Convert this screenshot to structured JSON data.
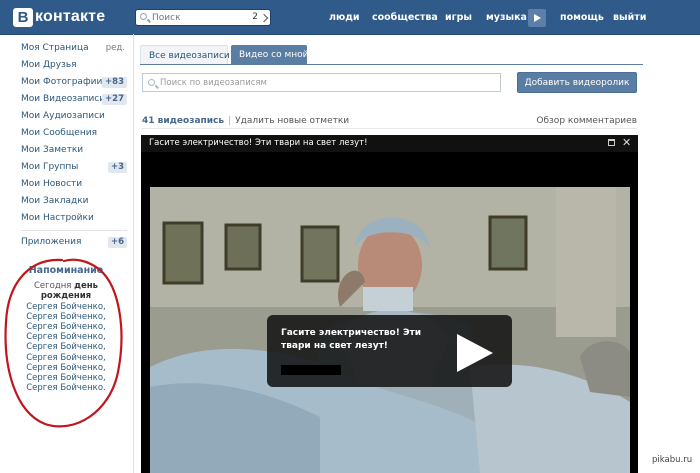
{
  "header": {
    "logo_letter": "B",
    "logo_text": "контакте",
    "search_placeholder": "Поиск",
    "search_count": "2",
    "nav": [
      "люди",
      "сообщества",
      "игры",
      "музыка",
      "помощь",
      "выйти"
    ]
  },
  "sidebar": {
    "items": [
      {
        "label": "Моя Страница",
        "edit": "ред."
      },
      {
        "label": "Мои Друзья"
      },
      {
        "label": "Мои Фотографии",
        "badge": "+83"
      },
      {
        "label": "Мои Видеозаписи",
        "badge": "+27"
      },
      {
        "label": "Мои Аудиозаписи"
      },
      {
        "label": "Мои Сообщения"
      },
      {
        "label": "Мои Заметки"
      },
      {
        "label": "Мои Группы",
        "badge": "+3"
      },
      {
        "label": "Мои Новости"
      },
      {
        "label": "Мои Закладки"
      },
      {
        "label": "Мои Настройки"
      }
    ],
    "apps": {
      "label": "Приложения",
      "badge": "+6"
    },
    "reminder": {
      "title": "Напоминание",
      "today": "Сегодня",
      "birthday": "день рождения",
      "names": "Сергея Бойченко, Сергея Бойченко, Сергея Бойченко, Сергея Бойченко, Сергея Бойченко, Сергея Бойченко, Сергея Бойченко, Сергея Бойченко, Сергея Бойченко."
    }
  },
  "main": {
    "tabs": [
      "Все видеозаписи",
      "Видео со мной"
    ],
    "search_placeholder": "Поиск по видеозаписям",
    "add_button": "Добавить видеоролик",
    "count_label": "41 видеозапись",
    "delete_label": "Удалить новые отметки",
    "review_label": "Обзор комментариев",
    "player": {
      "title": "Гасите электричество! Эти твари на свет лезут!",
      "overlay_title": "Гасите электричество! Эти твари на свет лезут!"
    }
  },
  "watermark": "pikabu.ru",
  "colors": {
    "header": "#2f5a89",
    "link": "#2b587a",
    "accent": "#597da3",
    "annotation": "#c0161d"
  }
}
